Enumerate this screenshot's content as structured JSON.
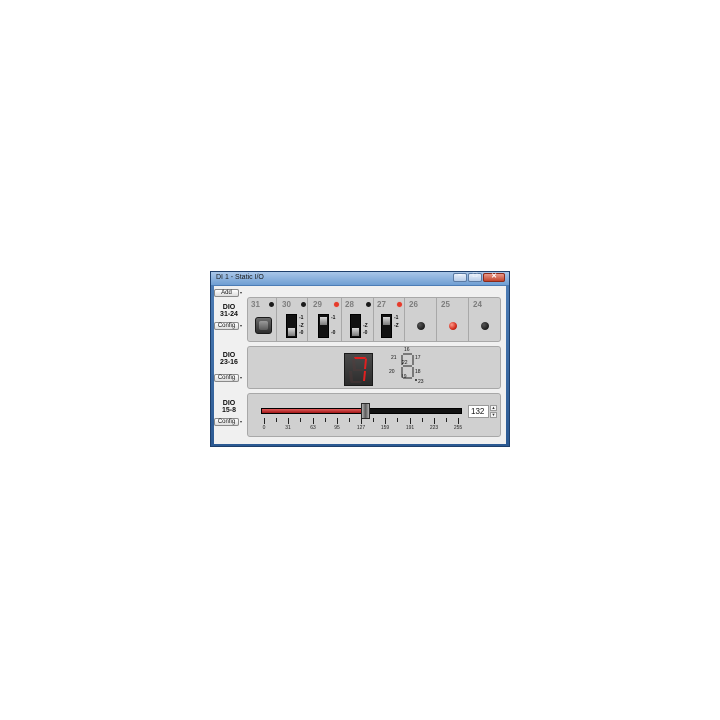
{
  "window": {
    "title": "DI 1 - Static I/O",
    "minimize": "–",
    "maximize": "□",
    "close": "✕"
  },
  "toolbar": {
    "add_label": "Add",
    "dropdown_icon": "▾"
  },
  "groups": [
    {
      "label_line1": "DIO",
      "label_line2": "31-24",
      "config_label": "Config"
    },
    {
      "label_line1": "DIO",
      "label_line2": "23-16",
      "config_label": "Config"
    },
    {
      "label_line1": "DIO",
      "label_line2": "15-8",
      "config_label": "Config"
    }
  ],
  "dio_31_24": {
    "bits": [
      "31",
      "30",
      "29",
      "28",
      "27",
      "26",
      "25",
      "24"
    ],
    "status_leds": [
      "off",
      "off",
      "red",
      "off",
      "red"
    ],
    "output_leds": [
      "off",
      "red",
      "off"
    ],
    "toggle_labels": {
      "one": "-1",
      "z": "-Z",
      "zero": "-0"
    }
  },
  "dio_23_16": {
    "digit": "7",
    "digit_color": "#e02020",
    "segment_labels": [
      "16",
      "17",
      "18",
      "19",
      "20",
      "21",
      "22",
      "23"
    ]
  },
  "dio_15_8": {
    "value": "132",
    "value_fraction": 0.5176,
    "tick_labels": [
      "0",
      "31",
      "63",
      "95",
      "127",
      "159",
      "191",
      "223",
      "255"
    ],
    "spin_up": "▲",
    "spin_down": "▼"
  }
}
